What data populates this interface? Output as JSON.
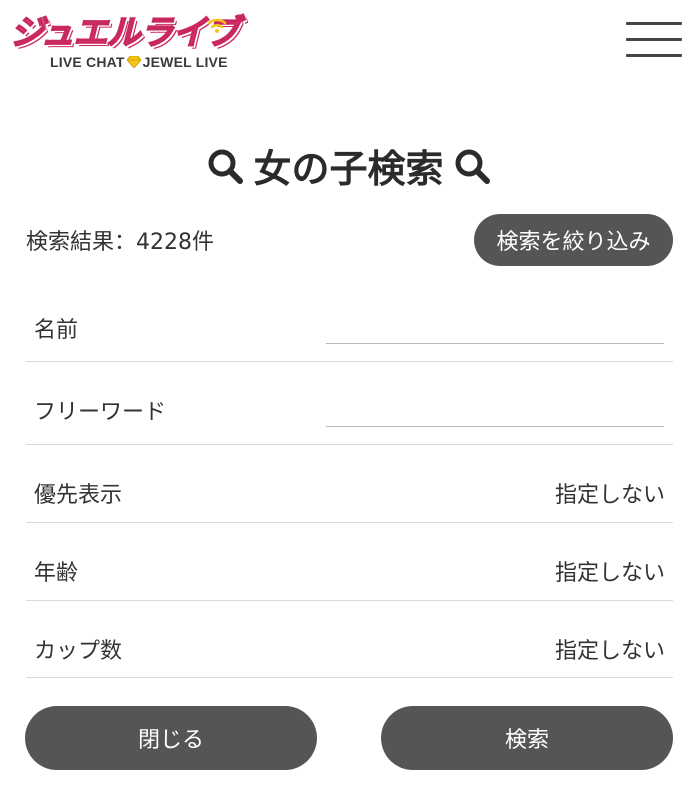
{
  "header": {
    "logo_main": "ジュエルライブ",
    "logo_sub_left": "LIVE CHAT",
    "logo_sub_right": "JEWEL LIVE",
    "menu_icon": "hamburger-menu-icon"
  },
  "search": {
    "title": "女の子検索",
    "title_icon": "search-icon",
    "result_count": "検索結果：4228件",
    "filter_button": "検索を絞り込み"
  },
  "form": {
    "name_label": "名前",
    "name_value": "",
    "freeword_label": "フリーワード",
    "freeword_value": "",
    "priority_label": "優先表示",
    "priority_value": "指定しない",
    "age_label": "年齢",
    "age_value": "指定しない",
    "cup_label": "カップ数",
    "cup_value": "指定しない"
  },
  "actions": {
    "close_label": "閉じる",
    "search_label": "検索"
  },
  "colors": {
    "logo_pink": "#f05a8e",
    "logo_pink_dark": "#c8285f",
    "button_gray": "#555555",
    "divider": "#d9d9d9",
    "gem_yellow": "#f5c518"
  }
}
